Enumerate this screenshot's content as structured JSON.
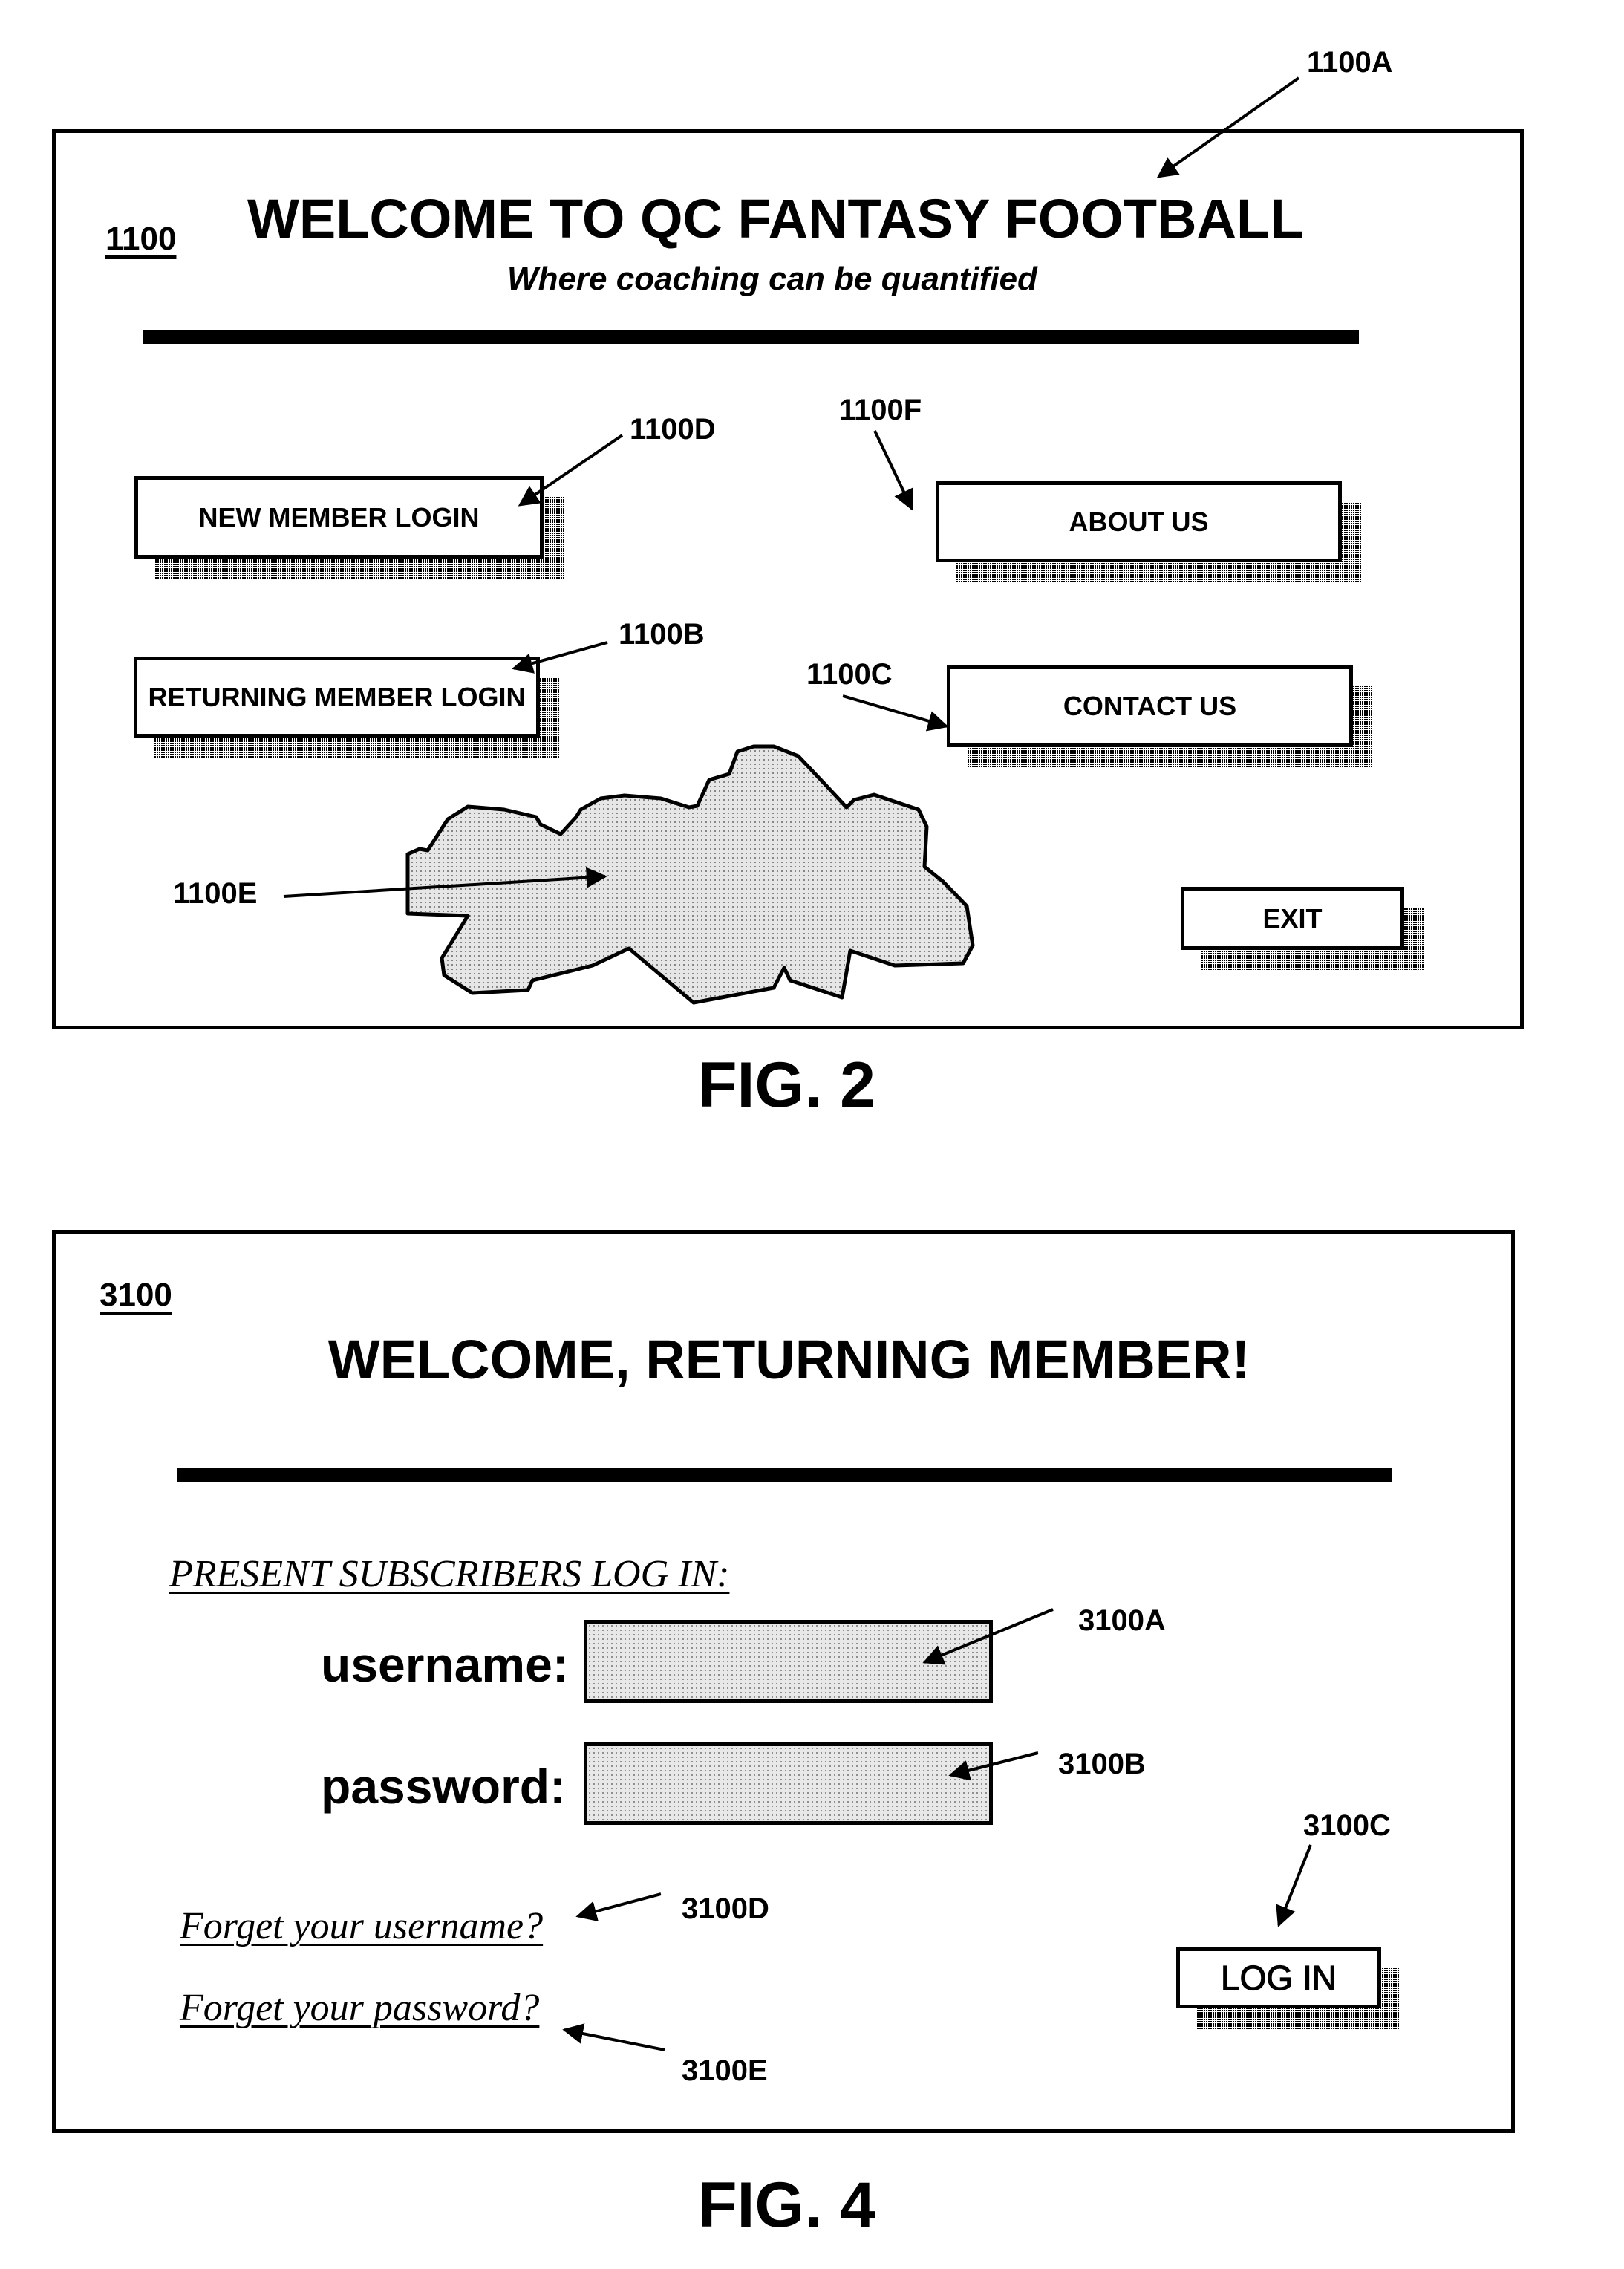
{
  "figure2": {
    "ref_screen": "1100",
    "title": "WELCOME TO QC FANTASY FOOTBALL",
    "subtitle": "Where coaching can be quantified",
    "buttons": {
      "new_member_login": "NEW MEMBER LOGIN",
      "returning_member_login": "RETURNING MEMBER LOGIN",
      "about_us": "ABOUT US",
      "contact_us": "CONTACT US",
      "exit": "EXIT"
    },
    "callouts": {
      "title": "1100A",
      "returning_member_login": "1100B",
      "contact_us": "1100C",
      "new_member_login": "1100D",
      "image_area": "1100E",
      "about_us": "1100F"
    },
    "caption": "FIG. 2"
  },
  "figure4": {
    "ref_screen": "3100",
    "title": "WELCOME, RETURNING MEMBER!",
    "section_heading": "PRESENT SUBSCRIBERS LOG IN:",
    "username_label": "username:",
    "password_label": "password:",
    "username_value": "",
    "password_value": "",
    "login_button": "LOG IN",
    "forgot_username": "Forget your username?",
    "forgot_password": "Forget your password?",
    "callouts": {
      "username_field": "3100A",
      "password_field": "3100B",
      "login_button": "3100C",
      "forgot_username": "3100D",
      "forgot_password": "3100E"
    },
    "caption": "FIG. 4"
  }
}
